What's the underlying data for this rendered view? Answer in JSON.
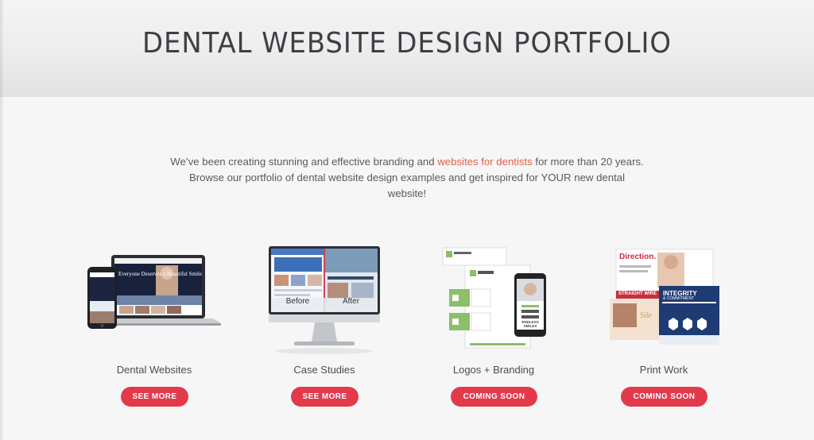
{
  "hero": {
    "title": "DENTAL WEBSITE DESIGN PORTFOLIO"
  },
  "intro": {
    "text_before": "We’ve been creating stunning and effective branding and ",
    "link": "websites for dentists",
    "text_after": " for more than 20 years. Browse our portfolio of dental website design examples and get inspired for YOUR new dental website!"
  },
  "portfolio": [
    {
      "label": "Dental Websites",
      "button": "SEE MORE",
      "mock_text": "Everyone Deserves a Beautiful Smile"
    },
    {
      "label": "Case Studies",
      "button": "SEE MORE",
      "before": "Before",
      "after": "After"
    },
    {
      "label": "Logos + Branding",
      "button": "COMING SOON",
      "brand_text": "ENDLESS SMILES"
    },
    {
      "label": "Print Work",
      "button": "COMING SOON",
      "flyer_title": "Direction.",
      "banner": "INTEGRITY",
      "banner_sub": "& COMMITMENT",
      "strip": "STRAIGHT WIRE",
      "tag": "Sile"
    }
  ],
  "colors": {
    "accent": "#e33a4b",
    "link": "#e2604a",
    "title": "#3d3f44"
  }
}
